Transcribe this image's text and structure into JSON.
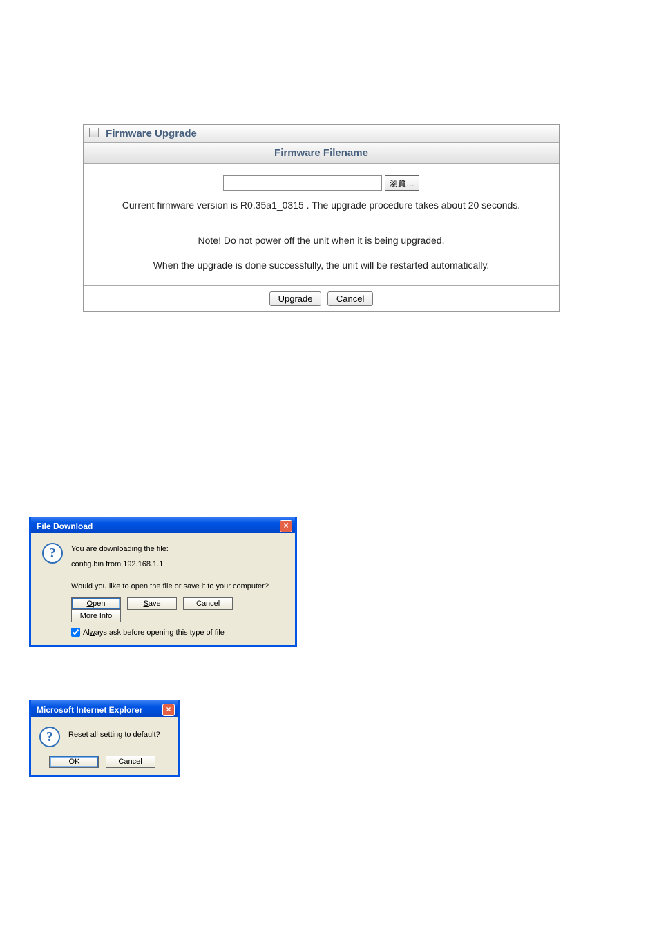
{
  "firmware": {
    "panel_title": "Firmware Upgrade",
    "section_title": "Firmware Filename",
    "browse_label": "瀏覽…",
    "version_line": "Current firmware version is  R0.35a1_0315 . The upgrade procedure takes about 20 seconds.",
    "note_line": "Note! Do not power off the unit when it is being upgraded.",
    "done_line": "When the upgrade is done successfully, the unit will be restarted automatically.",
    "upgrade_label": "Upgrade",
    "cancel_label": "Cancel"
  },
  "file_download": {
    "title": "File Download",
    "line1": "You are downloading the file:",
    "line2": "config.bin from 192.168.1.1",
    "prompt": "Would you like to open the file or save it to your computer?",
    "open": "Open",
    "save": "Save",
    "cancel": "Cancel",
    "more_info": "More Info",
    "checkbox_label": "Always ask before opening this type of file",
    "checkbox_checked": true
  },
  "confirm": {
    "title": "Microsoft Internet Explorer",
    "message": "Reset all setting to default?",
    "ok": "OK",
    "cancel": "Cancel"
  }
}
